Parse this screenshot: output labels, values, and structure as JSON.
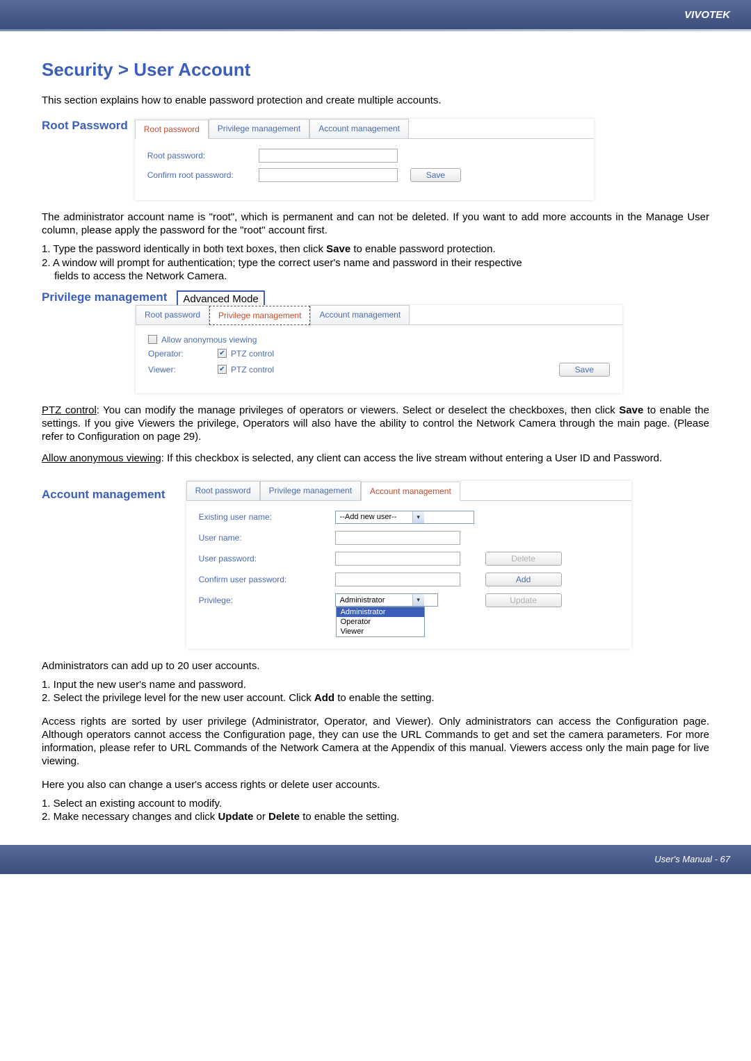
{
  "header": {
    "brand": "VIVOTEK"
  },
  "page": {
    "title": "Security > User Account",
    "intro": "This section explains how to enable password protection and create multiple accounts."
  },
  "root_password": {
    "heading": "Root Password",
    "tabs": {
      "root": "Root password",
      "privilege": "Privilege management",
      "account": "Account management"
    },
    "labels": {
      "root_password": "Root password:",
      "confirm_root": "Confirm root password:"
    },
    "save": "Save",
    "desc1": "The administrator account name is \"root\", which is permanent and can not be deleted. If you want to add more accounts in the Manage User column, please apply the password for the \"root\" account first.",
    "step1": "1. Type the password identically in both text boxes, then click ",
    "step1_bold": "Save",
    "step1_tail": " to enable password protection.",
    "step2": "2. A window will prompt for authentication; type the correct user's name and password in their respective",
    "step2_cont": "fields to access the Network Camera."
  },
  "privilege": {
    "heading": "Privilege management",
    "badge": "Advanced Mode",
    "tabs": {
      "root": "Root password",
      "privilege": "Privilege management",
      "account": "Account management"
    },
    "allow_anon": "Allow anonymous viewing",
    "operator": "Operator:",
    "viewer": "Viewer:",
    "ptz": "PTZ control",
    "save": "Save",
    "ptz_label": "PTZ control",
    "ptz_desc": ": You can modify the manage privileges of operators or viewers. Select or deselect the checkboxes, then click ",
    "ptz_bold": "Save",
    "ptz_tail": " to enable the settings. If you give Viewers the privilege, Operators will also have the ability to control the Network Camera through the main page. (Please refer to Configuration on page 29).",
    "anon_label": "Allow anonymous viewing",
    "anon_desc": ": If this checkbox is selected, any client can access the live stream without entering a User ID and Password."
  },
  "account": {
    "heading": "Account management",
    "tabs": {
      "root": "Root password",
      "privilege": "Privilege management",
      "account": "Account management"
    },
    "labels": {
      "existing": "Existing user name:",
      "username": "User name:",
      "userpass": "User password:",
      "confirm": "Confirm user password:",
      "privilege": "Privilege:"
    },
    "select_existing": "--Add new user--",
    "priv_value": "Administrator",
    "priv_options": [
      "Administrator",
      "Operator",
      "Viewer"
    ],
    "delete": "Delete",
    "add": "Add",
    "update": "Update",
    "desc1": "Administrators can add up to 20 user accounts.",
    "step1": "1. Input the new user's name and password.",
    "step2a": "2. Select the privilege level for the new user account. Click ",
    "step2_bold": "Add",
    "step2b": " to enable the setting.",
    "para2": "Access rights are sorted by user privilege (Administrator, Operator, and Viewer). Only administrators can access the Configuration page. Although operators cannot access the Configuration page, they can use the URL Commands to get and set the camera parameters. For more information, please refer to URL Commands of the Network Camera at the Appendix of this manual. Viewers access only the main page for live viewing.",
    "para3": "Here you also can change a user's access rights or delete user accounts.",
    "step3": "1. Select an existing account to modify.",
    "step4a": "2. Make necessary changes and click ",
    "step4_bold1": "Update",
    "step4_mid": " or ",
    "step4_bold2": "Delete",
    "step4b": " to enable the setting."
  },
  "footer": {
    "text": "User's Manual - 67"
  }
}
